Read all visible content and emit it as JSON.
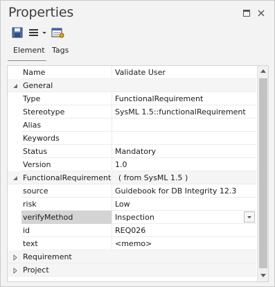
{
  "window": {
    "title": "Properties",
    "maximize_icon": "maximize-icon",
    "close_icon": "close-icon"
  },
  "toolbar": {
    "save_icon": "save-icon",
    "menu_icon": "menu-icon",
    "properties_icon": "properties-icon"
  },
  "tabs": [
    {
      "label": "Element",
      "active": true
    },
    {
      "label": "Tags",
      "active": false
    }
  ],
  "grid": {
    "name_row": {
      "name": "Name",
      "value": "Validate User"
    },
    "groups": {
      "general": "General",
      "functional": "FunctionalRequirement   ( from SysML 1.5 )",
      "requirement": "Requirement",
      "project": "Project"
    },
    "general_rows": [
      {
        "name": "Type",
        "value": "FunctionalRequirement"
      },
      {
        "name": "Stereotype",
        "value": "SysML 1.5::functionalRequirement"
      },
      {
        "name": "Alias",
        "value": ""
      },
      {
        "name": "Keywords",
        "value": ""
      },
      {
        "name": "Status",
        "value": "Mandatory"
      },
      {
        "name": "Version",
        "value": "1.0"
      }
    ],
    "functional_rows": [
      {
        "name": "source",
        "value": "Guidebook for DB Integrity 12.3"
      },
      {
        "name": "risk",
        "value": "Low"
      },
      {
        "name": "verifyMethod",
        "value": "Inspection"
      },
      {
        "name": "id",
        "value": "REQ026"
      },
      {
        "name": "text",
        "value": "<memo>"
      }
    ]
  },
  "colors": {
    "selected_row": "#d4d4d4",
    "scroll_thumb": "#c2c2c2",
    "title_text": "#3c3c3c"
  }
}
